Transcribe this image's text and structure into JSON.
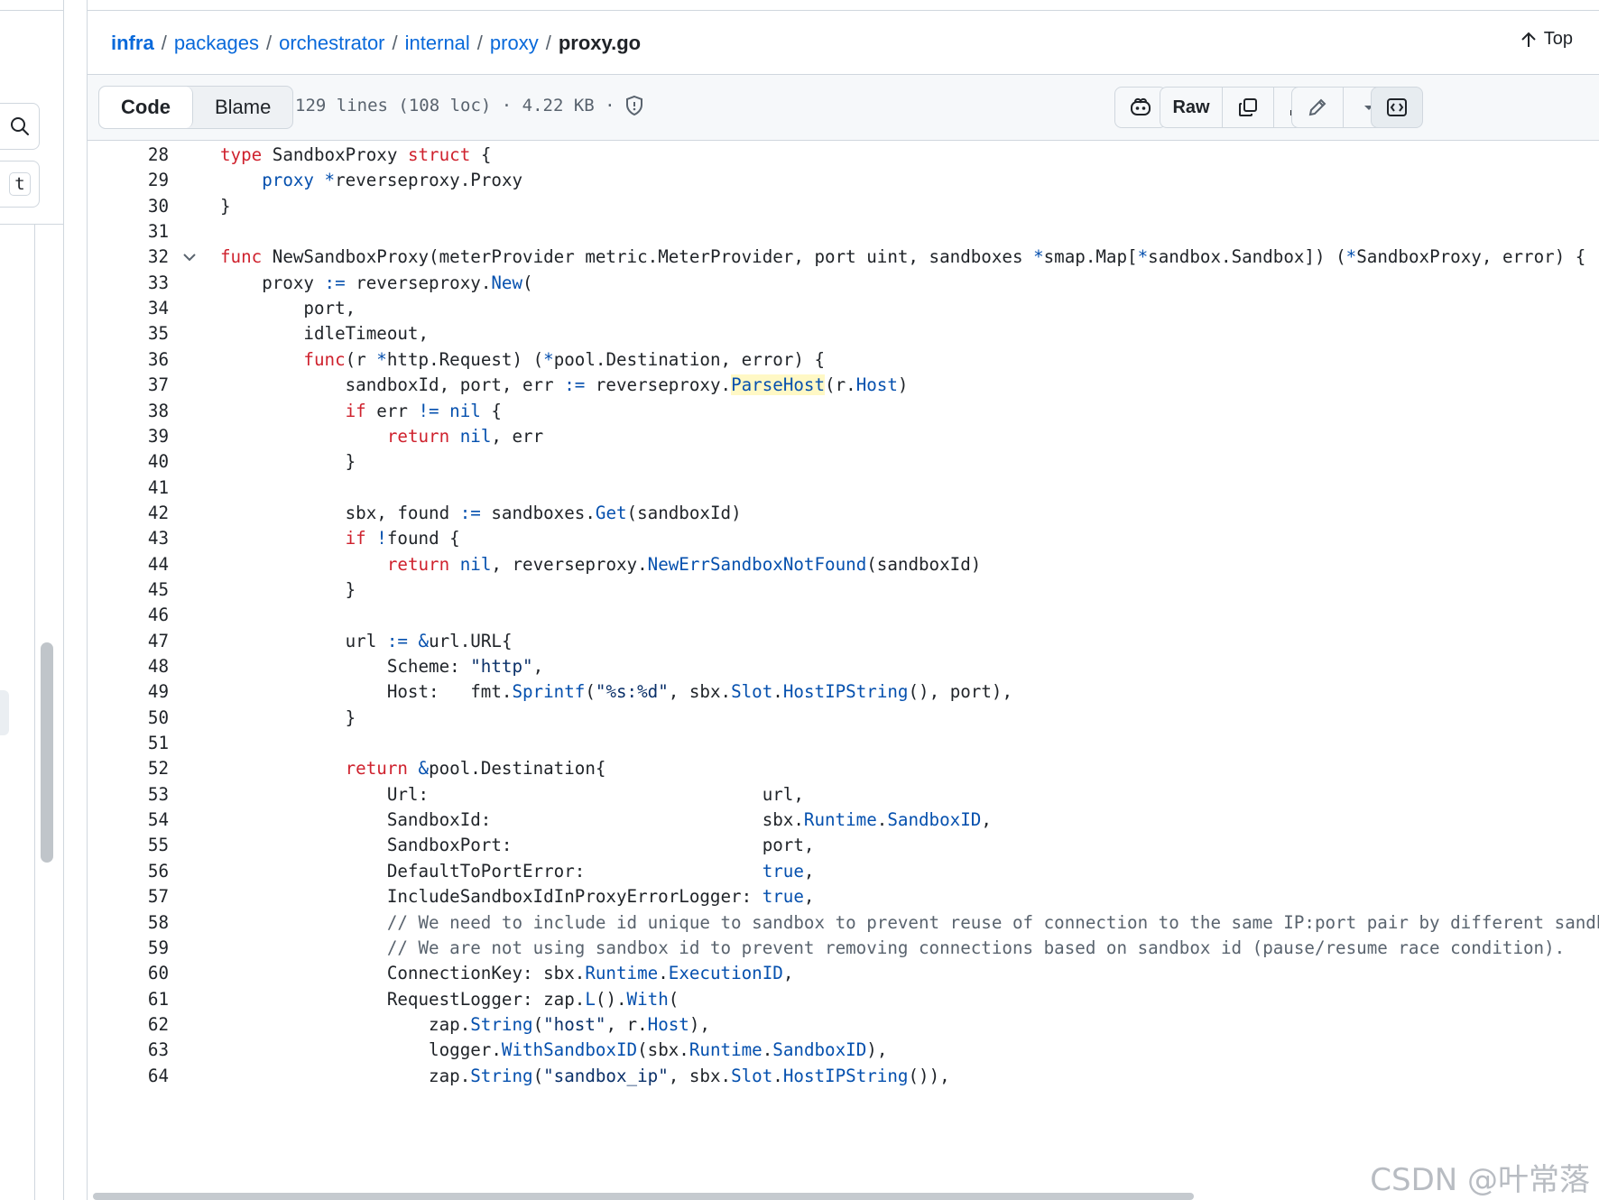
{
  "breadcrumb": {
    "items": [
      "infra",
      "packages",
      "orchestrator",
      "internal",
      "proxy"
    ],
    "separator": "/",
    "current": "proxy.go"
  },
  "top_link": "Top",
  "rail": {
    "key_hint": "t"
  },
  "file_header": {
    "tabs": [
      "Code",
      "Blame"
    ],
    "meta": "129 lines (108 loc) · 4.22 KB ·",
    "raw_label": "Raw"
  },
  "watermark": "CSDN @叶常落",
  "colors": {
    "keyword": "#cf222e",
    "function": "#0550ae",
    "string": "#0a3069",
    "comment": "#59636e",
    "link": "#0969da"
  },
  "code": {
    "lines": [
      {
        "n": "28",
        "t": "type SandboxProxy struct {"
      },
      {
        "n": "29",
        "t": "    proxy *reverseproxy.Proxy"
      },
      {
        "n": "30",
        "t": "}"
      },
      {
        "n": "31",
        "t": ""
      },
      {
        "n": "32",
        "t": "func NewSandboxProxy(meterProvider metric.MeterProvider, port uint, sandboxes *smap.Map[*sandbox.Sandbox]) (*SandboxProxy, error) {"
      },
      {
        "n": "33",
        "t": "    proxy := reverseproxy.New("
      },
      {
        "n": "34",
        "t": "        port,"
      },
      {
        "n": "35",
        "t": "        idleTimeout,"
      },
      {
        "n": "36",
        "t": "        func(r *http.Request) (*pool.Destination, error) {"
      },
      {
        "n": "37",
        "t": "            sandboxId, port, err := reverseproxy.ParseHost(r.Host)"
      },
      {
        "n": "38",
        "t": "            if err != nil {"
      },
      {
        "n": "39",
        "t": "                return nil, err"
      },
      {
        "n": "40",
        "t": "            }"
      },
      {
        "n": "41",
        "t": ""
      },
      {
        "n": "42",
        "t": "            sbx, found := sandboxes.Get(sandboxId)"
      },
      {
        "n": "43",
        "t": "            if !found {"
      },
      {
        "n": "44",
        "t": "                return nil, reverseproxy.NewErrSandboxNotFound(sandboxId)"
      },
      {
        "n": "45",
        "t": "            }"
      },
      {
        "n": "46",
        "t": ""
      },
      {
        "n": "47",
        "t": "            url := &url.URL{"
      },
      {
        "n": "48",
        "t": "                Scheme: \"http\","
      },
      {
        "n": "49",
        "t": "                Host:   fmt.Sprintf(\"%s:%d\", sbx.Slot.HostIPString(), port),"
      },
      {
        "n": "50",
        "t": "            }"
      },
      {
        "n": "51",
        "t": ""
      },
      {
        "n": "52",
        "t": "            return &pool.Destination{"
      },
      {
        "n": "53",
        "t": "                Url:                                url,"
      },
      {
        "n": "54",
        "t": "                SandboxId:                          sbx.Runtime.SandboxID,"
      },
      {
        "n": "55",
        "t": "                SandboxPort:                        port,"
      },
      {
        "n": "56",
        "t": "                DefaultToPortError:                 true,"
      },
      {
        "n": "57",
        "t": "                IncludeSandboxIdInProxyErrorLogger: true,"
      },
      {
        "n": "58",
        "t": "                // We need to include id unique to sandbox to prevent reuse of connection to the same IP:port pair by different sandb"
      },
      {
        "n": "59",
        "t": "                // We are not using sandbox id to prevent removing connections based on sandbox id (pause/resume race condition)."
      },
      {
        "n": "60",
        "t": "                ConnectionKey: sbx.Runtime.ExecutionID,"
      },
      {
        "n": "61",
        "t": "                RequestLogger: zap.L().With("
      },
      {
        "n": "62",
        "t": "                    zap.String(\"host\", r.Host),"
      },
      {
        "n": "63",
        "t": "                    logger.WithSandboxID(sbx.Runtime.SandboxID),"
      },
      {
        "n": "64",
        "t": "                    zap.String(\"sandbox_ip\", sbx.Slot.HostIPString()),"
      }
    ]
  }
}
